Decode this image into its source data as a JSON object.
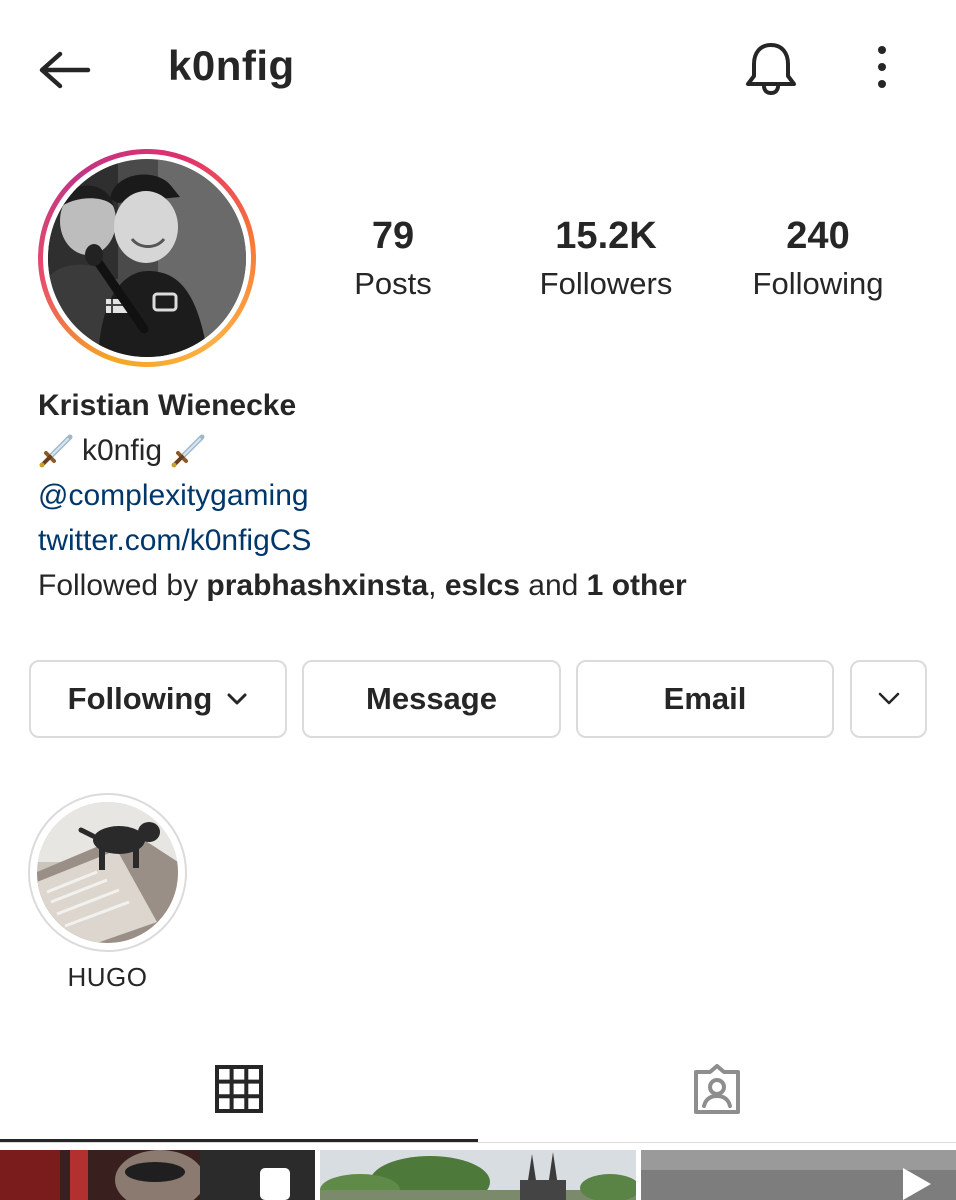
{
  "header": {
    "username": "k0nfig",
    "back_icon": "arrow-left-icon",
    "notifications_icon": "bell-icon",
    "menu_icon": "more-vertical-icon"
  },
  "profile": {
    "avatar": "profile-photo",
    "stats": {
      "posts": {
        "value": "79",
        "label": "Posts"
      },
      "followers": {
        "value": "15.2K",
        "label": "Followers"
      },
      "following": {
        "value": "240",
        "label": "Following"
      }
    }
  },
  "bio": {
    "name": "Kristian Wienecke",
    "tagline": "k0nfig",
    "tagline_icon": "dagger-icon",
    "mention": "@complexitygaming",
    "link": "twitter.com/k0nfigCS",
    "followed_by": {
      "prefix": "Followed by",
      "user1": "prabhashxinsta",
      "sep": ",",
      "user2": "eslcs",
      "and": "and",
      "others": "1 other"
    }
  },
  "actions": {
    "following_label": "Following",
    "message_label": "Message",
    "email_label": "Email",
    "expand_icon": "chevron-down-icon"
  },
  "highlights": [
    {
      "label": "HUGO"
    }
  ],
  "tabs": {
    "grid_icon": "grid-icon",
    "tagged_icon": "tagged-person-icon",
    "active": "grid"
  },
  "colors": {
    "text": "#262626",
    "link": "#00376b",
    "border": "#dbdbdb",
    "story_ring_start": "#f5a623",
    "story_ring_end": "#c13584"
  }
}
